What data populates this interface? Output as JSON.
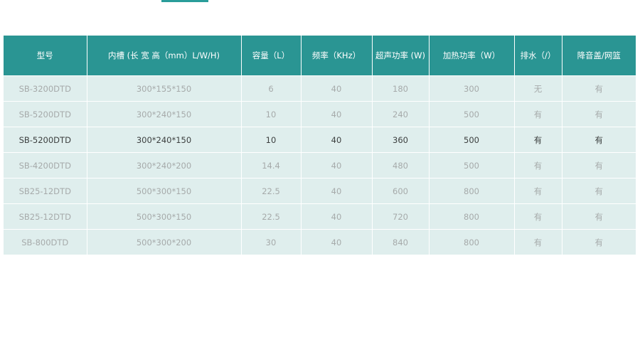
{
  "colors": {
    "header_bg": "#2a9593",
    "accent": "#2a9d9a",
    "row_bg": "#dfeeed",
    "row_text": "#a6aaaa",
    "highlight_text": "#3c3f3f"
  },
  "table": {
    "headers": [
      "型号",
      "内槽 (长 宽 高（mm）L/W/H)",
      "容量（L）",
      "频率（KHz）",
      "超声功率 (W)",
      "加热功率（W）",
      "排水（/）",
      "降音盖/网篮"
    ],
    "rows": [
      [
        "SB-3200DTD",
        "300*155*150",
        "6",
        "40",
        "180",
        "300",
        "无",
        "有"
      ],
      [
        "SB-5200DTD",
        "300*240*150",
        "10",
        "40",
        "240",
        "500",
        "有",
        "有"
      ],
      [
        "SB-5200DTD",
        "300*240*150",
        "10",
        "40",
        "360",
        "500",
        "有",
        "有"
      ],
      [
        "SB-4200DTD",
        "300*240*200",
        "14.4",
        "40",
        "480",
        "500",
        "有",
        "有"
      ],
      [
        "SB25-12DTD",
        "500*300*150",
        "22.5",
        "40",
        "600",
        "800",
        "有",
        "有"
      ],
      [
        "SB25-12DTD",
        "500*300*150",
        "22.5",
        "40",
        "720",
        "800",
        "有",
        "有"
      ],
      [
        "SB-800DTD",
        "500*300*200",
        "30",
        "40",
        "840",
        "800",
        "有",
        "有"
      ]
    ]
  }
}
